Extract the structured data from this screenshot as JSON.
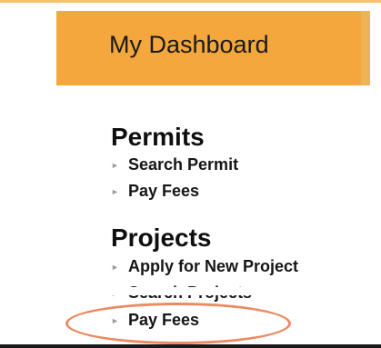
{
  "header": {
    "title": "My Dashboard"
  },
  "sections": [
    {
      "heading": "Permits",
      "links": [
        "Search Permit",
        "Pay Fees"
      ]
    },
    {
      "heading": "Projects",
      "links": [
        "Apply for New Project",
        "Search Projects",
        "Pay Fees"
      ]
    }
  ],
  "arrow_glyph": "►",
  "colors": {
    "header_bg": "#f3a73d",
    "highlight_ring": "#ec8a62"
  }
}
